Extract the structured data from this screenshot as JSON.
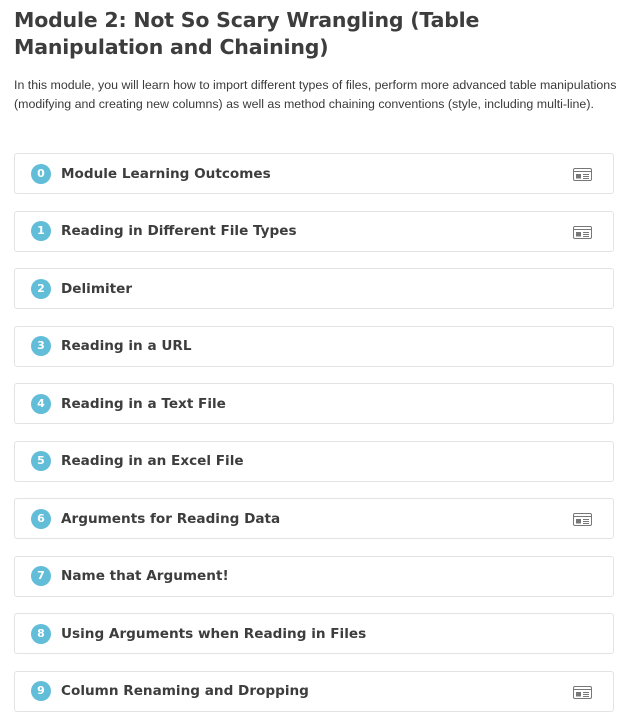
{
  "module": {
    "title": "Module 2: Not So Scary Wrangling (Table Manipulation and Chaining)",
    "description": "In this module, you will learn how to import different types of files, perform more advanced table manipulations (modifying and creating new columns) as well as method chaining conventions (style, including multi-line)."
  },
  "colors": {
    "number_badge": "#62bdd9",
    "card_border": "#e3e3e3",
    "text": "#3d3d3d"
  },
  "chapters": [
    {
      "number": "0",
      "title": "Module Learning Outcomes",
      "icon": "slides-icon"
    },
    {
      "number": "1",
      "title": "Reading in Different File Types",
      "icon": "slides-icon"
    },
    {
      "number": "2",
      "title": "Delimiter",
      "icon": null
    },
    {
      "number": "3",
      "title": "Reading in a URL",
      "icon": null
    },
    {
      "number": "4",
      "title": "Reading in a Text File",
      "icon": null
    },
    {
      "number": "5",
      "title": "Reading in an Excel File",
      "icon": null
    },
    {
      "number": "6",
      "title": "Arguments for Reading Data",
      "icon": "slides-icon"
    },
    {
      "number": "7",
      "title": "Name that Argument!",
      "icon": null
    },
    {
      "number": "8",
      "title": "Using Arguments when Reading in Files",
      "icon": null
    },
    {
      "number": "9",
      "title": "Column Renaming and Dropping",
      "icon": "slides-icon"
    }
  ]
}
